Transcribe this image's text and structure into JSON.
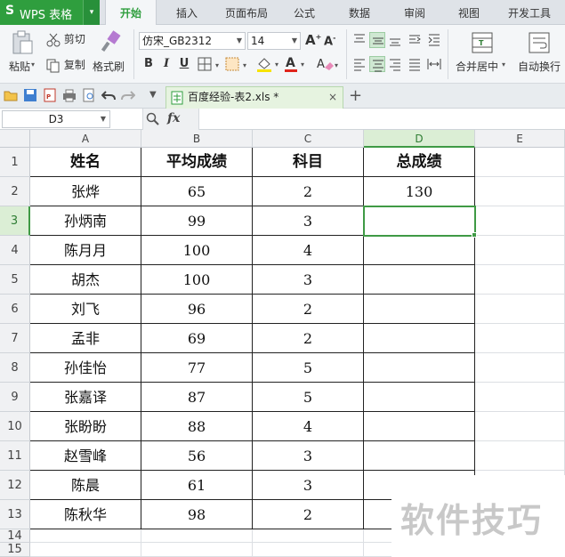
{
  "app": {
    "menu_logo": "S",
    "menu_title": "WPS 表格",
    "menu_caret": "▾"
  },
  "tabs": [
    {
      "label": "开始",
      "active": true
    },
    {
      "label": "插入"
    },
    {
      "label": "页面布局"
    },
    {
      "label": "公式"
    },
    {
      "label": "数据"
    },
    {
      "label": "审阅"
    },
    {
      "label": "视图"
    },
    {
      "label": "开发工具"
    }
  ],
  "ribbon": {
    "paste_label": "粘贴",
    "cut_label": "剪切",
    "copy_label": "复制",
    "format_painter_label": "格式刷",
    "font_name": "仿宋_GB2312",
    "font_size": "14",
    "bold": "B",
    "italic": "I",
    "underline": "U",
    "merge_center_label": "合并居中",
    "wrap_text_label": "自动换行"
  },
  "document": {
    "tab_title": "百度经验-表2.xls *",
    "close": "×",
    "new_tab": "+"
  },
  "formula_bar": {
    "name_box": "D3",
    "fx": "fx",
    "value": ""
  },
  "sheet": {
    "columns": [
      "A",
      "B",
      "C",
      "D",
      "E"
    ],
    "rows": [
      "1",
      "2",
      "3",
      "4",
      "5",
      "6",
      "7",
      "8",
      "9",
      "10",
      "11",
      "12",
      "13",
      "14",
      "15"
    ],
    "header": [
      "姓名",
      "平均成绩",
      "科目",
      "总成绩"
    ],
    "data": [
      [
        "张烨",
        "65",
        "2",
        "130"
      ],
      [
        "孙炳南",
        "99",
        "3",
        ""
      ],
      [
        "陈月月",
        "100",
        "4",
        ""
      ],
      [
        "胡杰",
        "100",
        "3",
        ""
      ],
      [
        "刘飞",
        "96",
        "2",
        ""
      ],
      [
        "孟非",
        "69",
        "2",
        ""
      ],
      [
        "孙佳怡",
        "77",
        "5",
        ""
      ],
      [
        "张嘉译",
        "87",
        "5",
        ""
      ],
      [
        "张盼盼",
        "88",
        "4",
        ""
      ],
      [
        "赵雪峰",
        "56",
        "3",
        ""
      ],
      [
        "陈晨",
        "61",
        "3",
        ""
      ],
      [
        "陈秋华",
        "98",
        "2",
        ""
      ]
    ],
    "selected_cell": "D3"
  },
  "watermark": "软件技巧",
  "colors": {
    "brand_green": "#2f9e3e",
    "selection_green": "#3f9a45"
  }
}
